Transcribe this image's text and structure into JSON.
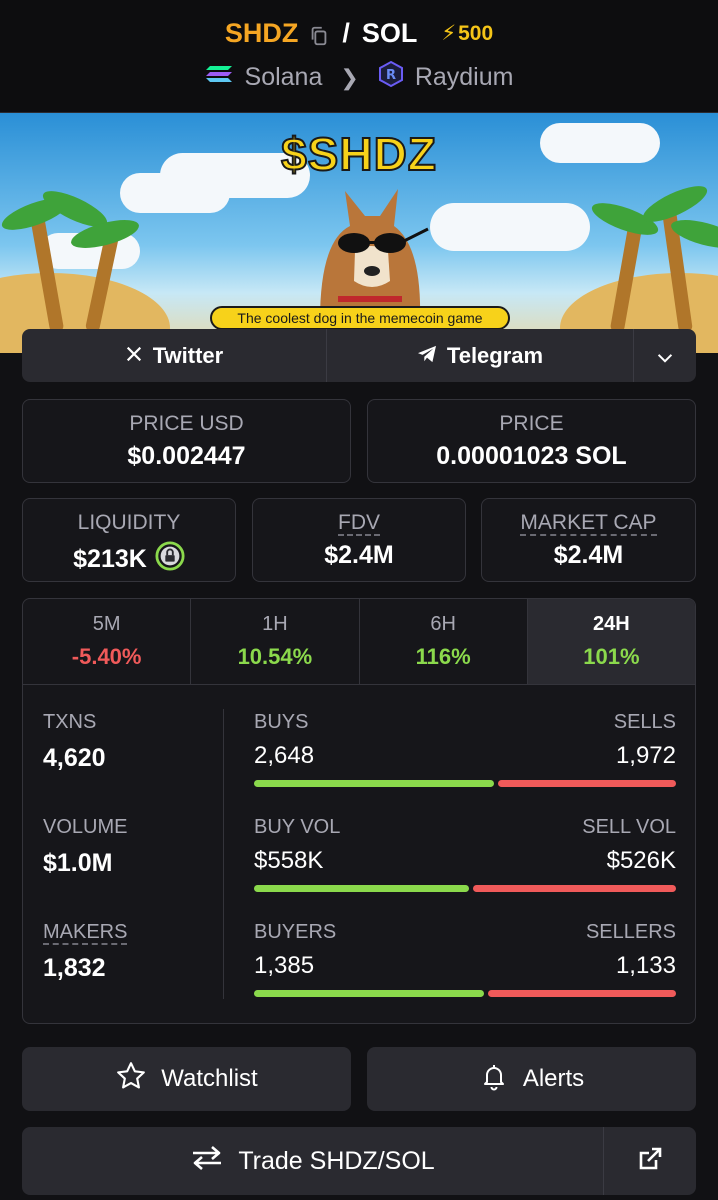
{
  "header": {
    "base": "SHDZ",
    "separator": "/",
    "quote": "SOL",
    "boost": "500",
    "chain": "Solana",
    "dex": "Raydium"
  },
  "banner": {
    "title": "$SHDZ",
    "tagline": "The coolest dog in the memecoin game"
  },
  "social": {
    "twitter": "Twitter",
    "telegram": "Telegram"
  },
  "prices": {
    "price_usd_label": "PRICE USD",
    "price_usd": "$0.002447",
    "price_label": "PRICE",
    "price_native": "0.00001023 SOL"
  },
  "metrics": {
    "liquidity_label": "LIQUIDITY",
    "liquidity": "$213K",
    "fdv_label": "FDV",
    "fdv": "$2.4M",
    "mcap_label": "MARKET CAP",
    "mcap": "$2.4M"
  },
  "timeframes": [
    {
      "label": "5M",
      "change": "-5.40%",
      "direction": "down"
    },
    {
      "label": "1H",
      "change": "10.54%",
      "direction": "up"
    },
    {
      "label": "6H",
      "change": "116%",
      "direction": "up"
    },
    {
      "label": "24H",
      "change": "101%",
      "direction": "up"
    }
  ],
  "stats": {
    "txns_label": "TXNS",
    "txns": "4,620",
    "buys_label": "BUYS",
    "buys": "2,648",
    "sells_label": "SELLS",
    "sells": "1,972",
    "buys_fraction": 0.573,
    "volume_label": "VOLUME",
    "volume": "$1.0M",
    "buy_vol_label": "BUY VOL",
    "buy_vol": "$558K",
    "sell_vol_label": "SELL VOL",
    "sell_vol": "$526K",
    "buy_vol_fraction": 0.515,
    "makers_label": "MAKERS",
    "makers": "1,832",
    "buyers_label": "BUYERS",
    "buyers": "1,385",
    "sellers_label": "SELLERS",
    "sellers": "1,133",
    "buyers_fraction": 0.55
  },
  "actions": {
    "watchlist": "Watchlist",
    "alerts": "Alerts",
    "trade": "Trade SHDZ/SOL"
  },
  "colors": {
    "accent": "#f5a623",
    "positive": "#8bd94c",
    "negative": "#f05a5a"
  }
}
